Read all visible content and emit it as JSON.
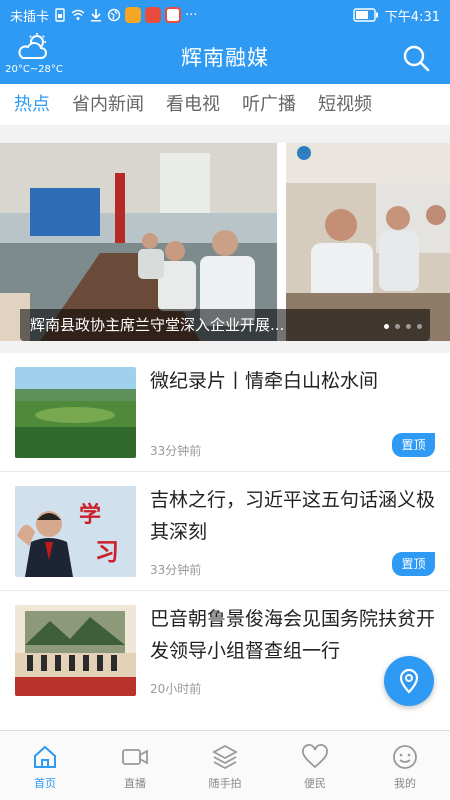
{
  "status_bar": {
    "carrier": "未插卡",
    "more": "···",
    "time": "下午4:31"
  },
  "header": {
    "weather_temp": "20°C~28°C",
    "title": "辉南融媒"
  },
  "tabs": [
    {
      "label": "热点",
      "active": true
    },
    {
      "label": "省内新闻",
      "active": false
    },
    {
      "label": "看电视",
      "active": false
    },
    {
      "label": "听广播",
      "active": false
    },
    {
      "label": "短视频",
      "active": false
    }
  ],
  "carousel": {
    "caption": "辉南县政协主席兰守堂深入企业开展...",
    "slide_count": 4,
    "active_index": 0
  },
  "news": [
    {
      "title": "微纪录片丨情牵白山松水间",
      "time": "33分钟前",
      "badge": "置顶"
    },
    {
      "title": "吉林之行，习近平这五句话涵义极其深刻",
      "time": "33分钟前",
      "badge": "置顶"
    },
    {
      "title": "巴音朝鲁景俊海会见国务院扶贫开发领导小组督查组一行",
      "time": "20小时前",
      "badge": ""
    }
  ],
  "bottom_nav": [
    {
      "label": "首页",
      "icon": "home-icon",
      "active": true
    },
    {
      "label": "直播",
      "icon": "video-camera-icon",
      "active": false
    },
    {
      "label": "随手拍",
      "icon": "layers-icon",
      "active": false
    },
    {
      "label": "便民",
      "icon": "heart-icon",
      "active": false
    },
    {
      "label": "我的",
      "icon": "smiley-icon",
      "active": false
    }
  ],
  "colors": {
    "accent": "#2f9af4",
    "tab_inactive": "#666666",
    "nav_inactive": "#888888"
  }
}
